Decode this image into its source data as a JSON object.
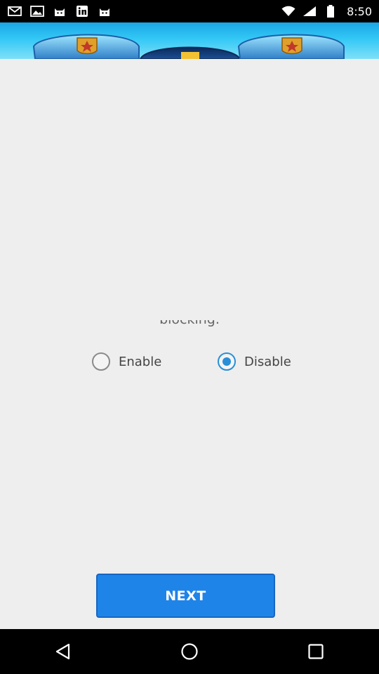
{
  "status_bar": {
    "time": "8:50",
    "left_icons": [
      "mail-icon",
      "photo-icon",
      "cat-icon",
      "linkedin-icon",
      "cat-icon"
    ],
    "right_icons": [
      "wifi-icon",
      "signal-icon",
      "battery-icon"
    ]
  },
  "content": {
    "partial_text": "blocking."
  },
  "radio": {
    "options": [
      {
        "label": "Enable",
        "checked": false
      },
      {
        "label": "Disable",
        "checked": true
      }
    ]
  },
  "next_button": {
    "label": "NEXT"
  },
  "nav_bar": {
    "icons": [
      "back-icon",
      "home-icon",
      "recents-icon"
    ]
  },
  "colors": {
    "accent": "#1f84e8",
    "radio_checked": "#2a8fd6",
    "background": "#eeeeee"
  }
}
